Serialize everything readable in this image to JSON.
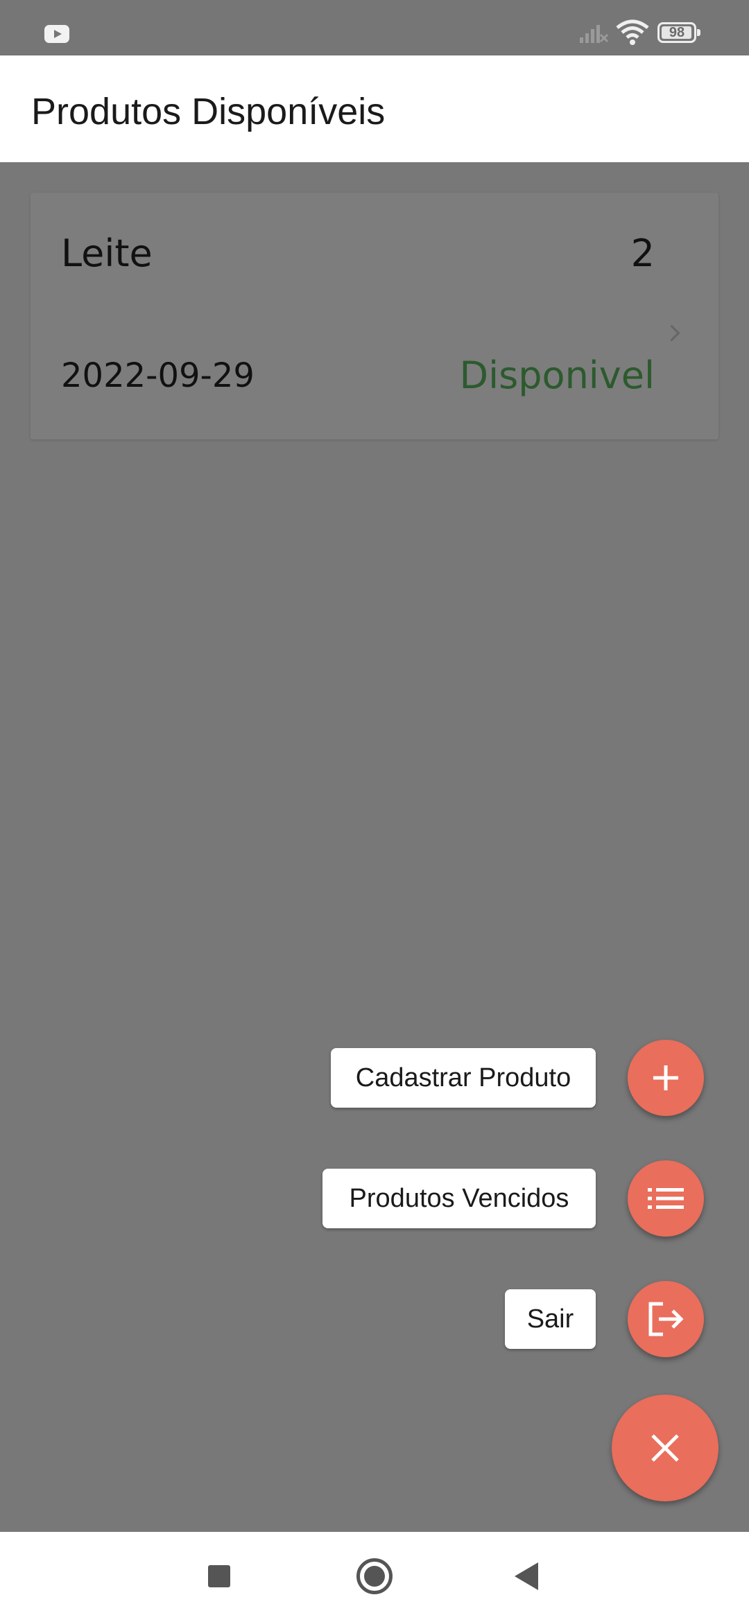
{
  "status_bar": {
    "battery": "98",
    "battery_level": 0.98,
    "icons": [
      "youtube-icon",
      "signal-icon",
      "wifi-icon",
      "battery-icon"
    ]
  },
  "app_bar": {
    "title": "Produtos Disponíveis"
  },
  "products": [
    {
      "name": "Leite",
      "quantity": "2",
      "date": "2022-09-29",
      "status": "Disponivel"
    }
  ],
  "speed_dial": {
    "actions": [
      {
        "label": "Cadastrar Produto",
        "icon": "plus-icon"
      },
      {
        "label": "Produtos Vencidos",
        "icon": "list-icon"
      },
      {
        "label": "Sair",
        "icon": "logout-icon"
      }
    ],
    "main_icon": "close-icon"
  },
  "nav_bar": {
    "icons": [
      "recents-icon",
      "home-icon",
      "back-icon"
    ]
  },
  "colors": {
    "accent": "#e96e5b",
    "status_available": "#2c5a2e",
    "overlay": "#787878"
  }
}
